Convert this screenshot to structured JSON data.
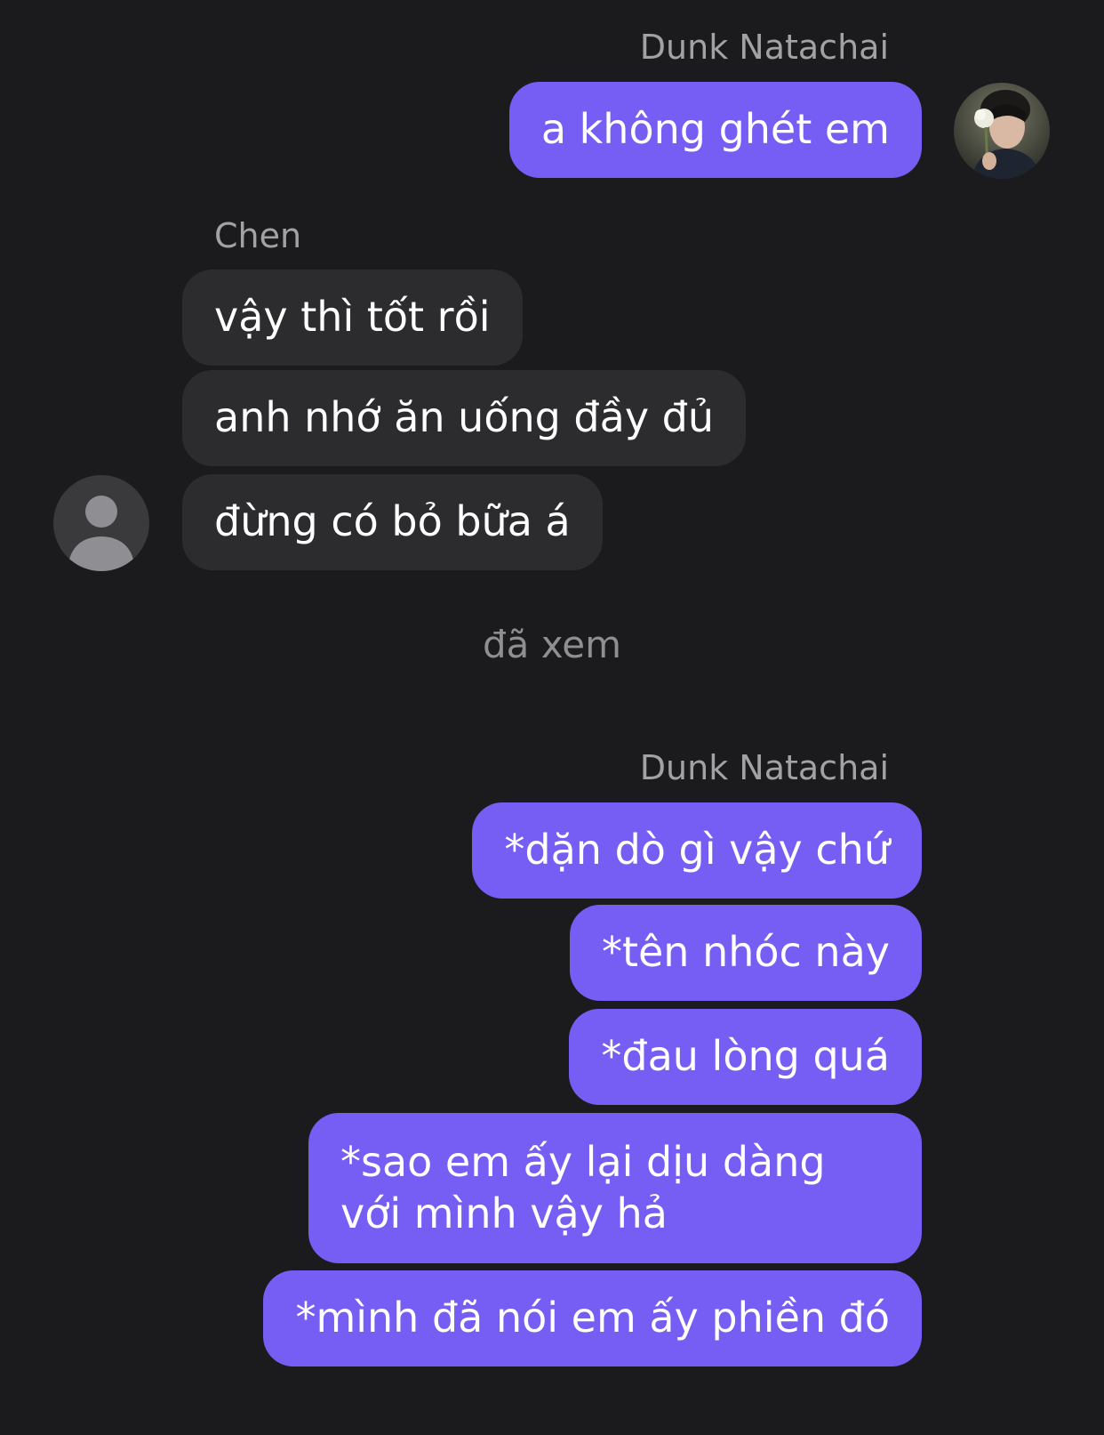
{
  "colors": {
    "background": "#1b1b1d",
    "outgoing_bubble": "#765df4",
    "incoming_bubble": "#2c2c2e",
    "sender_name": "#a2a2a6",
    "seen_text": "#8e8e93"
  },
  "group1": {
    "sender": "Dunk Natachai",
    "avatar_icon": "profile-photo-avatar",
    "messages": [
      "a không ghét em"
    ]
  },
  "group2": {
    "sender": "Chen",
    "avatar_icon": "default-person-avatar",
    "messages": [
      "vậy thì tốt rồi",
      "anh nhớ ăn uống đầy đủ",
      "đừng có bỏ bữa á"
    ]
  },
  "seen_status": "đã xem",
  "group3": {
    "sender": "Dunk Natachai",
    "messages": [
      "*dặn dò gì vậy chứ",
      "*tên nhóc này",
      "*đau lòng quá",
      "*sao em ấy lại dịu dàng với mình vậy hả",
      "*mình đã nói em ấy phiền đó"
    ]
  }
}
